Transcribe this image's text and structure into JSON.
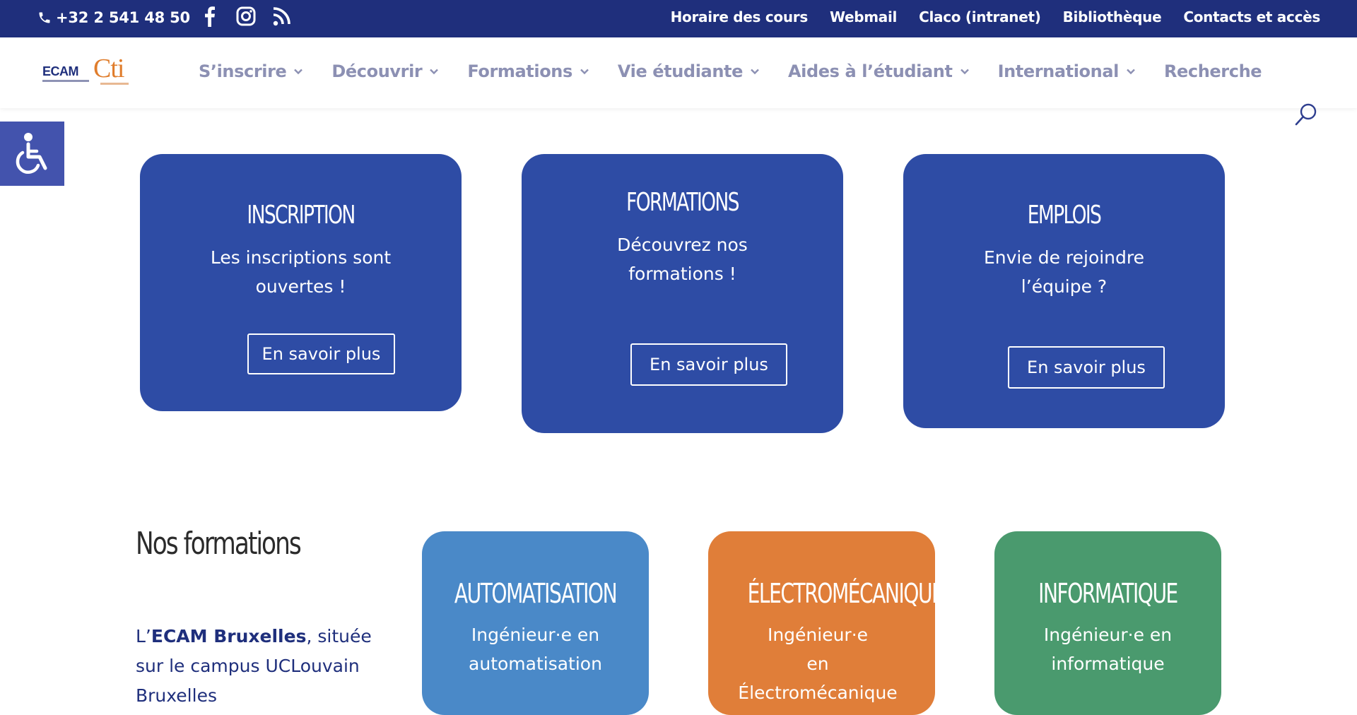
{
  "topbar": {
    "phone": "+32 2 541 48 50",
    "links": [
      "Horaire des cours",
      "Webmail",
      "Claco (intranet)",
      "Bibliothèque",
      "Contacts et accès"
    ]
  },
  "header": {
    "logo": {
      "ecam": "ECAM",
      "cti": "Cti"
    },
    "nav": [
      "S’inscrire",
      "Découvrir",
      "Formations",
      "Vie étudiante",
      "Aides à l’étudiant",
      "International",
      "Recherche"
    ]
  },
  "cards": [
    {
      "title": "INSCRIPTION",
      "lines": [
        "Les inscriptions sont",
        "ouvertes !"
      ],
      "button": "En savoir plus"
    },
    {
      "title": "FORMATIONS",
      "lines": [
        "Découvrez nos",
        "formations !"
      ],
      "button": "En savoir plus"
    },
    {
      "title": "EMPLOIS",
      "lines": [
        "Envie de rejoindre",
        "l’équipe ?"
      ],
      "button": "En savoir plus"
    }
  ],
  "nos_formations": {
    "title": "Nos formations",
    "intro_prefix": "L’",
    "intro_bold": "ECAM Bruxelles",
    "intro_rest": ", située",
    "line2": "sur le campus UCLouvain",
    "line3": "Bruxelles"
  },
  "formation_cards": [
    {
      "title": "AUTOMATISATION",
      "lines": [
        "Ingénieur·e en",
        "automatisation"
      ],
      "color": "#4a89c8"
    },
    {
      "title": "ÉLECTROMÉCANIQUE",
      "lines": [
        "Ingénieur·e",
        "en",
        "Électromécanique"
      ],
      "color": "#e07e39"
    },
    {
      "title": "INFORMATIQUE",
      "lines": [
        "Ingénieur·e en",
        "informatique"
      ],
      "color": "#4a9a6e"
    }
  ],
  "colors": {
    "topbar": "#1f2f7c",
    "card": "#2e4ca5",
    "nav_text": "#8c90b3",
    "accent_orange": "#e07d2c"
  }
}
